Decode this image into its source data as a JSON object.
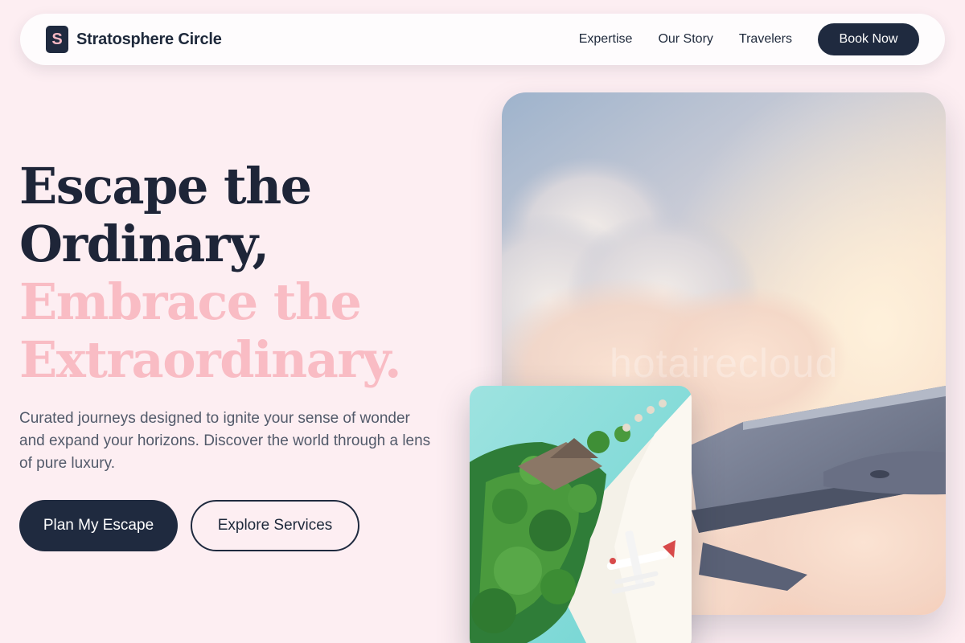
{
  "header": {
    "logo_letter": "S",
    "brand_name": "Stratosphere Circle",
    "nav": [
      {
        "label": "Expertise"
      },
      {
        "label": "Our Story"
      },
      {
        "label": "Travelers"
      }
    ],
    "cta_label": "Book Now"
  },
  "hero": {
    "title_lines": [
      "Escape the",
      "Ordinary,",
      "Embrace the",
      "Extraordinary."
    ],
    "subtitle": "Curated journeys designed to ignite your sense of wonder and expand your horizons. Discover the world through a lens of pure luxury.",
    "primary_button": "Plan My Escape",
    "secondary_button": "Explore Services"
  },
  "images": {
    "sky_watermark": "hotairecloud",
    "sky_icon": "airplane-wing-over-clouds",
    "beach_icon": "tropical-island-with-seaplane"
  },
  "colors": {
    "background": "#fdeef2",
    "navy": "#1f2a3f",
    "accent_pink": "#f9bcc4",
    "body_text": "#525a6a"
  }
}
